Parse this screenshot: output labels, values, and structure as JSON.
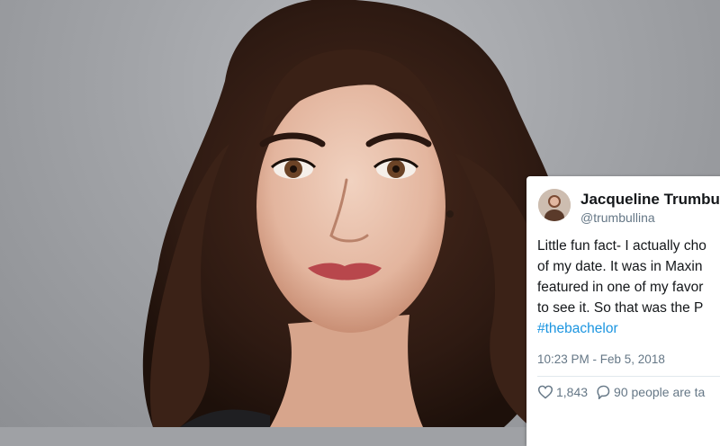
{
  "image": {
    "description_icon": "portrait-photo",
    "background_color": "#9fa1a5"
  },
  "tweet": {
    "display_name": "Jacqueline Trumbu",
    "handle": "@trumbullina",
    "text_lines": [
      "Little fun fact- I actually cho",
      "of my date. It was in Maxin",
      "featured in one of my favor",
      "to see it. So that was the P"
    ],
    "hashtag": "#thebachelor",
    "timestamp": "10:23 PM - Feb 5, 2018",
    "likes": "1,843",
    "replies": "90 people are ta",
    "link_color": "#1b95e0"
  }
}
